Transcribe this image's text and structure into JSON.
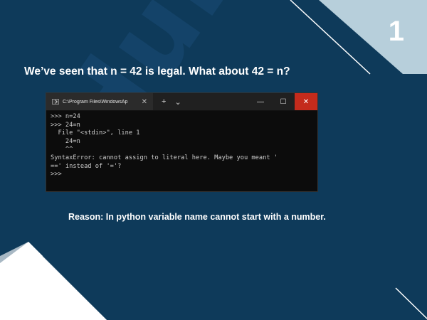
{
  "slide": {
    "number": "1",
    "watermark_text": "Hubert 24",
    "question": "We’ve seen that n = 42 is legal. What about 42 = n?",
    "reason": "Reason: In python variable name cannot start with a number."
  },
  "terminal": {
    "tab_title": "C:\\Program Files\\WindowsAp",
    "tab_close": "✕",
    "new_tab": "+",
    "dropdown": "⌄",
    "minimize": "—",
    "maximize": "☐",
    "close": "✕",
    "output": ">>> n=24\n>>> 24=n\n  File \"<stdin>\", line 1\n    24=n\n    ^^\nSyntaxError: cannot assign to literal here. Maybe you meant '\n==' instead of '='?\n>>>"
  },
  "colors": {
    "background": "#0e3a5a",
    "accent_triangle": "#b7cfdb",
    "close_button": "#c42b1c"
  }
}
